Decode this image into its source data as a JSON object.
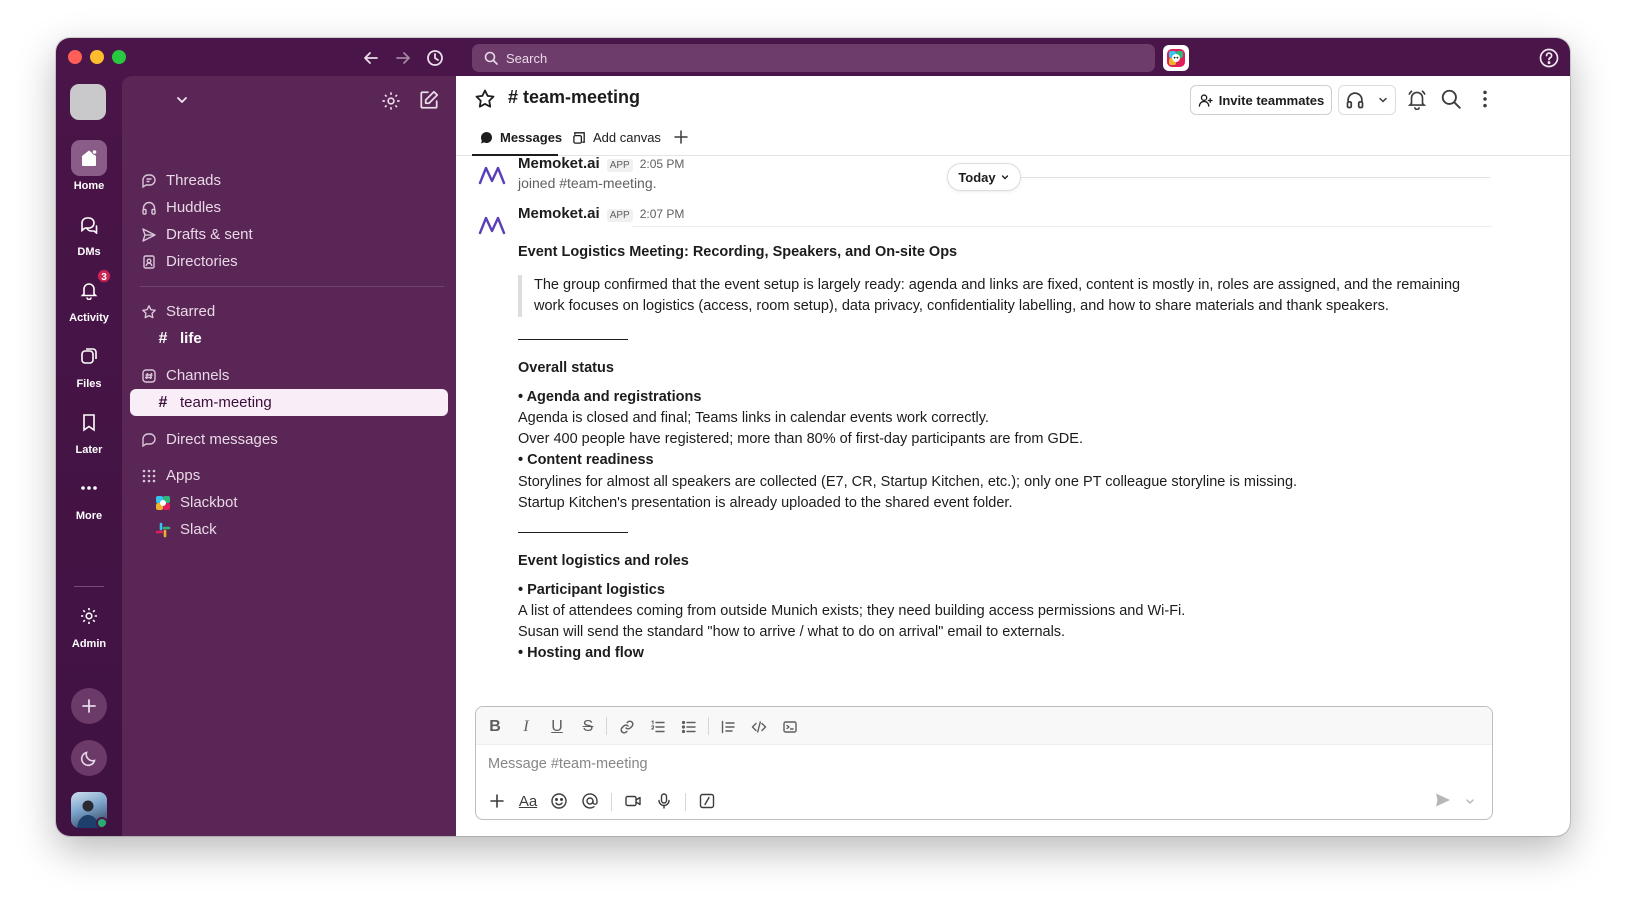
{
  "search": {
    "placeholder": "Search"
  },
  "rail": {
    "items": [
      {
        "label": "Home",
        "icon": "home-icon"
      },
      {
        "label": "DMs",
        "icon": "dms-icon"
      },
      {
        "label": "Activity",
        "icon": "bell-icon",
        "badge": "3"
      },
      {
        "label": "Files",
        "icon": "files-icon"
      },
      {
        "label": "Later",
        "icon": "bookmark-icon"
      },
      {
        "label": "More",
        "icon": "more-icon"
      },
      {
        "label": "Admin",
        "icon": "gear-icon"
      }
    ]
  },
  "sidebar": {
    "nav": [
      {
        "label": "Threads",
        "icon": "threads-icon"
      },
      {
        "label": "Huddles",
        "icon": "headphones-icon"
      },
      {
        "label": "Drafts & sent",
        "icon": "send-icon"
      },
      {
        "label": "Directories",
        "icon": "directory-icon"
      }
    ],
    "starred_label": "Starred",
    "starred_channels": [
      "life"
    ],
    "channels_label": "Channels",
    "channels": [
      "team-meeting"
    ],
    "dm_label": "Direct messages",
    "apps_label": "Apps",
    "apps": [
      "Slackbot",
      "Slack"
    ]
  },
  "channel": {
    "title": "# team-meeting",
    "invite_label": "Invite teammates",
    "tabs": {
      "messages": "Messages",
      "add_canvas": "Add canvas"
    }
  },
  "messages": {
    "today_label": "Today",
    "items": [
      {
        "sender": "Memoket.ai",
        "app_tag": "APP",
        "time": "2:05 PM",
        "text": "joined #team-meeting."
      },
      {
        "sender": "Memoket.ai",
        "app_tag": "APP",
        "time": "2:07 PM",
        "title": "Event Logistics Meeting: Recording, Speakers, and On-site Ops",
        "quote": "The group confirmed that the event setup is largely ready: agenda and links are fixed, content is mostly in, roles are assigned, and the remaining work focuses on logistics (access, room setup), data privacy, confidentiality labelling, and how to share materials and thank speakers.",
        "section1_title": "Overall status",
        "s1_b1": "• Agenda and registrations",
        "s1_l1": "Agenda is closed and final; Teams links in calendar events work correctly.",
        "s1_l2": "Over 400 people have registered; more than 80% of first-day participants are from GDE.",
        "s1_b2": "• Content readiness",
        "s1_l3": "Storylines for almost all speakers are collected (E7, CR, Startup Kitchen, etc.); only one PT colleague storyline is missing.",
        "s1_l4": "Startup Kitchen's presentation is already uploaded to the shared event folder.",
        "section2_title": "Event logistics and roles",
        "s2_b1": "• Participant logistics",
        "s2_l1": "A list of attendees coming from outside Munich exists; they need building access permissions and Wi-Fi.",
        "s2_l2": "Susan will send the standard \"how to arrive / what to do on arrival\" email to externals.",
        "s2_b2": "• Hosting and flow"
      }
    ]
  },
  "composer": {
    "placeholder": "Message #team-meeting"
  },
  "colors": {
    "aubergine": "#4a1548",
    "sidebar": "#5a2656",
    "selected": "#f9edf7",
    "badge": "#cd2553"
  }
}
